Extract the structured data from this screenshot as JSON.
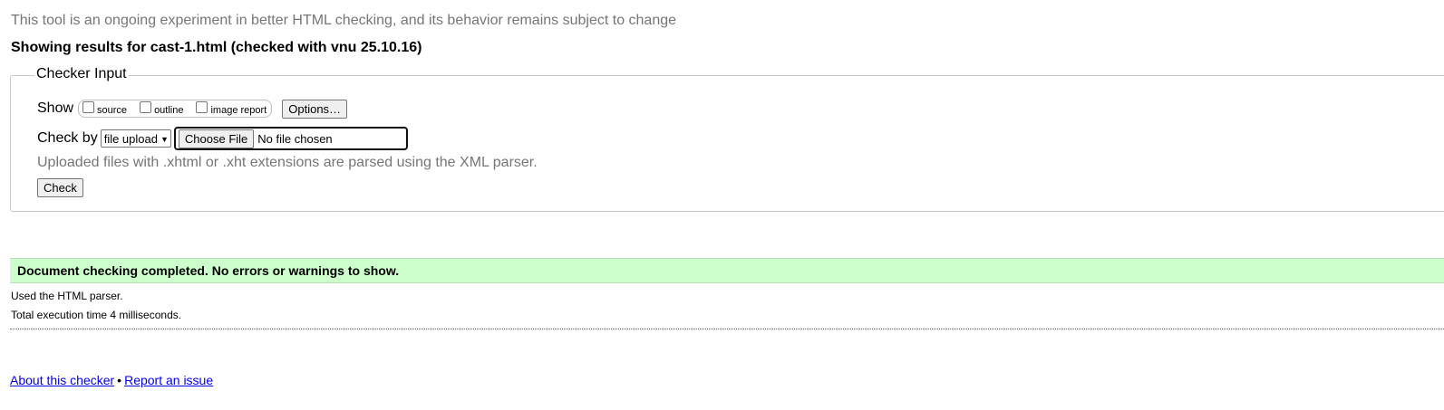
{
  "intro_text": "This tool is an ongoing experiment in better HTML checking, and its behavior remains subject to change",
  "results_title": "Showing results for cast-1.html (checked with vnu 25.10.16)",
  "checker_input": {
    "legend": "Checker Input",
    "show_label": "Show",
    "show_options": [
      {
        "label": "source",
        "checked": false
      },
      {
        "label": "outline",
        "checked": false
      },
      {
        "label": "image report",
        "checked": false
      }
    ],
    "options_button": "Options…",
    "check_by_label": "Check by",
    "check_by_selected": "file upload",
    "choose_file_button": "Choose File",
    "file_status": "No file chosen",
    "hint": "Uploaded files with .xhtml or .xht extensions are parsed using the XML parser.",
    "check_button": "Check"
  },
  "result": {
    "status": "Document checking completed. No errors or warnings to show.",
    "parser_note": "Used the HTML parser.",
    "execution_time": "Total execution time 4 milliseconds."
  },
  "footer": {
    "about_link": "About this checker",
    "separator": "•",
    "report_link": "Report an issue"
  },
  "colors": {
    "success_bg": "#ccffcc",
    "muted_text": "#767676",
    "link": "#0000ee"
  }
}
